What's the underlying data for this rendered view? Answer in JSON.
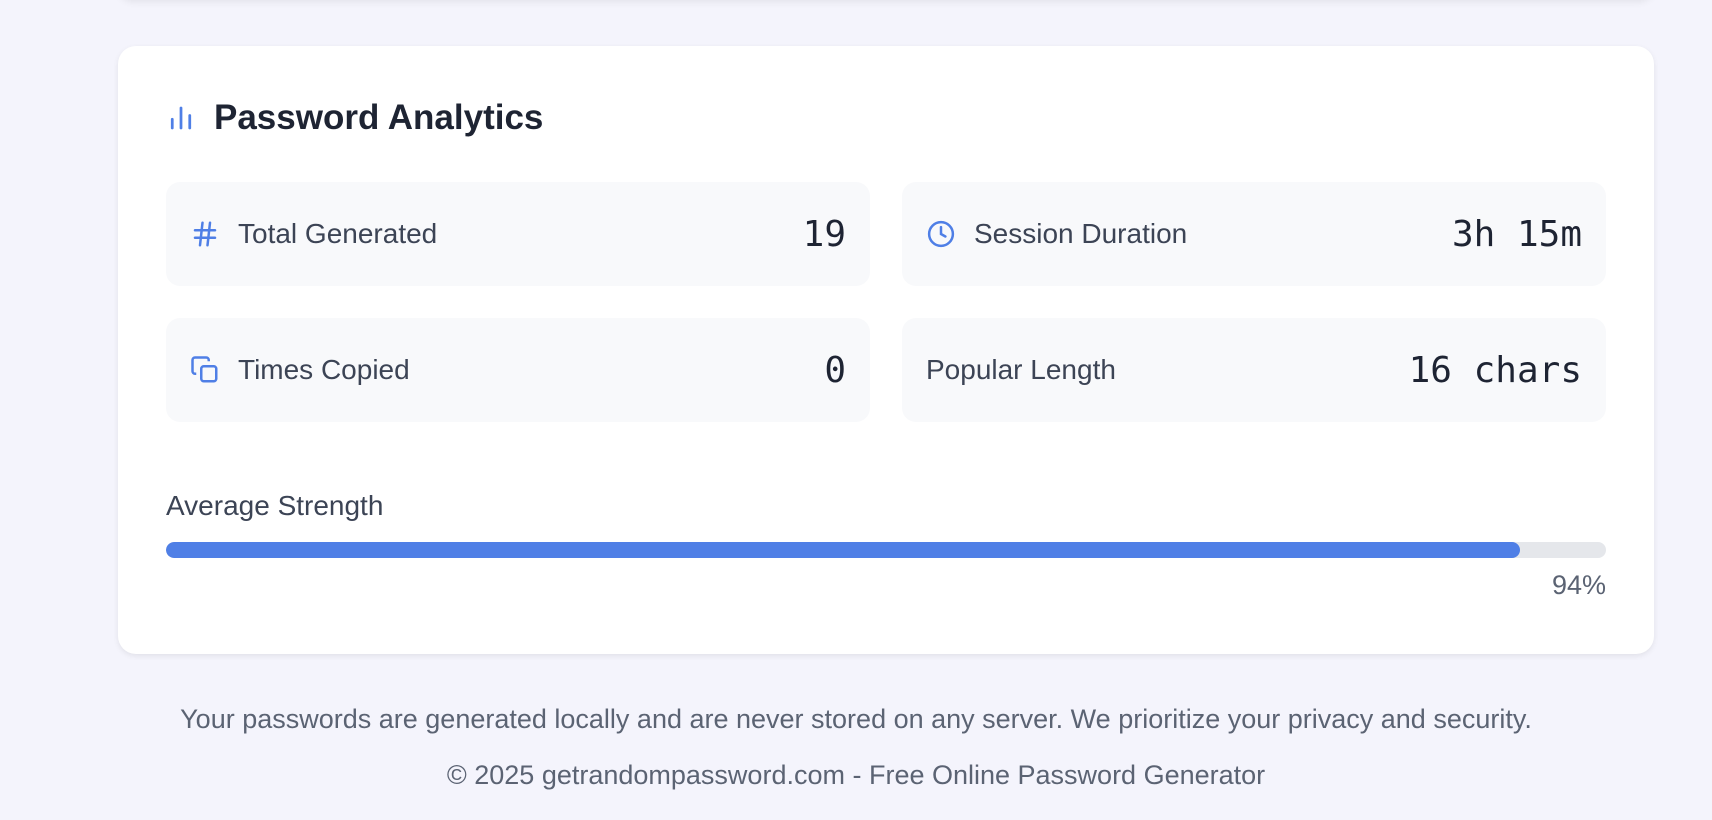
{
  "analytics": {
    "title": "Password Analytics",
    "title_icon": "bar-chart-icon",
    "accent_color": "#4f7fe6",
    "stats": {
      "total_generated": {
        "label": "Total Generated",
        "value": "19",
        "icon": "hash-icon"
      },
      "session_duration": {
        "label": "Session Duration",
        "value": "3h 15m",
        "icon": "clock-icon"
      },
      "times_copied": {
        "label": "Times Copied",
        "value": "0",
        "icon": "copy-icon"
      },
      "popular_length": {
        "label": "Popular Length",
        "value": "16 chars"
      }
    },
    "average_strength": {
      "label": "Average Strength",
      "percent": 94,
      "percent_text": "94%"
    }
  },
  "footer": {
    "note": "Your passwords are generated locally and are never stored on any server. We prioritize your privacy and security.",
    "copyright": "© 2025 getrandompassword.com - Free Online Password Generator"
  }
}
